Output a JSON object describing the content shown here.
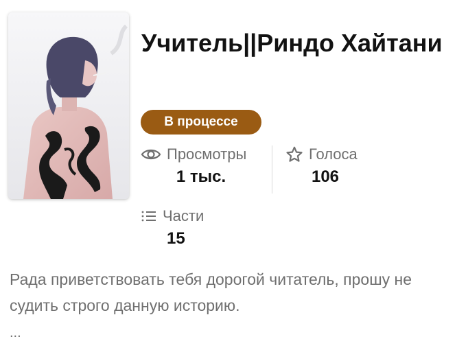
{
  "story": {
    "title": "Учитель||Риндо Хайтани",
    "status_label": "В процессе",
    "status_color": "#9a5b13"
  },
  "stats": {
    "views": {
      "label": "Просмотры",
      "value": "1 тыс.",
      "icon": "eye-icon"
    },
    "votes": {
      "label": "Голоса",
      "value": "106",
      "icon": "star-icon"
    },
    "parts": {
      "label": "Части",
      "value": "15",
      "icon": "list-icon"
    }
  },
  "description": {
    "text": "Рада приветствовать тебя дорогой читатель, прошу не судить строго данную историю.",
    "more": "..."
  }
}
